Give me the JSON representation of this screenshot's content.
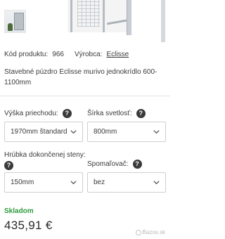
{
  "product": {
    "code_label": "Kód produktu:",
    "code_value": "966",
    "manufacturer_label": "Výrobca:",
    "manufacturer_value": "Eclisse",
    "description": "Stavebné púzdro Eclisse murivo jednokrídlo 600-1100mm"
  },
  "options": {
    "height": {
      "label": "Výška priechodu:",
      "help": "?",
      "value": "1970mm štandard"
    },
    "width": {
      "label": "Šírka svetlosť:",
      "help": "?",
      "value": "800mm"
    },
    "wall": {
      "label": "Hrúbka dokončenej steny:",
      "help": "?",
      "value": "150mm"
    },
    "brake": {
      "label": "Spomaľovač:",
      "help": "?",
      "value": "bez"
    }
  },
  "availability": "Skladom",
  "price": "435,91 €",
  "watermark": "Bazos.sk",
  "icons": {
    "help": "question-circle-icon",
    "chevron": "chevron-down-icon",
    "watermark": "bazos-logo-icon"
  },
  "colors": {
    "stock_green": "#2e9b3c",
    "help_bg": "#3a3a3a",
    "text": "#3b3b3b"
  }
}
